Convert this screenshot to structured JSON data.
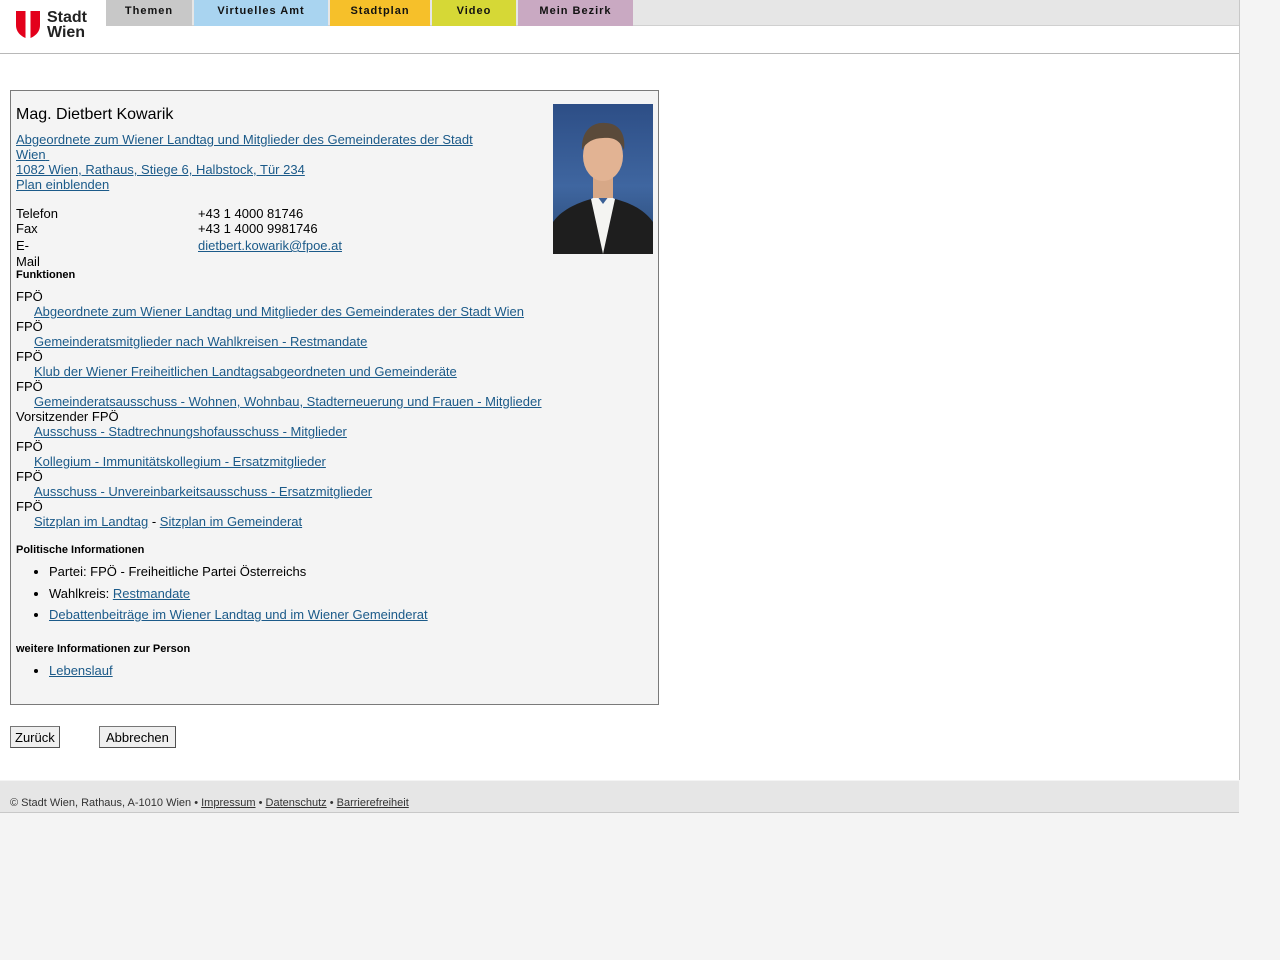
{
  "logo": {
    "line1": "Stadt",
    "line2": "Wien"
  },
  "nav": {
    "tabs": [
      {
        "label": "Themen",
        "color": "#c8c8c8"
      },
      {
        "label": "Virtuelles Amt",
        "color": "#a9d4f0"
      },
      {
        "label": "Stadtplan",
        "color": "#f6c02a"
      },
      {
        "label": "Video",
        "color": "#d6d836"
      },
      {
        "label": "Mein Bezirk",
        "color": "#c9a9c2"
      }
    ]
  },
  "person": {
    "name": "Mag. Dietbert Kowarik",
    "role_line1": "Abgeordnete zum Wiener Landtag und Mitglieder des Gemeinderates der Stadt",
    "role_line2": "Wien",
    "address": "1082 Wien, Rathaus, Stiege 6, Halbstock, Tür 234",
    "map_link": "Plan einblenden",
    "phone_label": "Telefon",
    "phone": "+43 1 4000 81746",
    "fax_label": "Fax",
    "fax": "+43 1 4000 9981746",
    "email_label": "E-Mail",
    "email": "dietbert.kowarik@fpoe.at"
  },
  "functions": {
    "title": "Funktionen",
    "items": [
      {
        "role": "FPÖ",
        "link": "Abgeordnete zum Wiener Landtag und Mitglieder des Gemeinderates der Stadt Wien"
      },
      {
        "role": "FPÖ",
        "link": "Gemeinderatsmitglieder nach Wahlkreisen - Restmandate"
      },
      {
        "role": "FPÖ",
        "link": "Klub der Wiener Freiheitlichen Landtagsabgeordneten und Gemeinderäte"
      },
      {
        "role": "FPÖ",
        "link": "Gemeinderatsausschuss - Wohnen, Wohnbau, Stadterneuerung und Frauen - Mitglieder"
      },
      {
        "role": "Vorsitzender FPÖ",
        "link": "Ausschuss - Stadtrechnungshofausschuss - Mitglieder"
      },
      {
        "role": "FPÖ",
        "link": "Kollegium - Immunitätskollegium - Ersatzmitglieder"
      },
      {
        "role": "FPÖ",
        "link": "Ausschuss - Unvereinbarkeitsausschuss - Ersatzmitglieder"
      }
    ],
    "last_role": "FPÖ",
    "seat_landtag": "Sitzplan im Landtag",
    "separator": "-",
    "seat_gemeinderat": "Sitzplan im Gemeinderat"
  },
  "political": {
    "title": "Politische Informationen",
    "party": "Partei: FPÖ - Freiheitliche Partei Österreichs",
    "district_label": "Wahlkreis:",
    "district_link": "Restmandate",
    "debates_link": "Debattenbeiträge im Wiener Landtag und im Wiener Gemeinderat"
  },
  "more": {
    "title": "weitere Informationen zur Person",
    "cv_link": "Lebenslauf"
  },
  "buttons": {
    "back": "Zurück",
    "cancel": "Abbrechen"
  },
  "footer": {
    "copyright": "© Stadt Wien, Rathaus, A-1010 Wien",
    "dot": "•",
    "impressum": "Impressum",
    "datenschutz": "Datenschutz",
    "barrierefreiheit": "Barrierefreiheit"
  }
}
